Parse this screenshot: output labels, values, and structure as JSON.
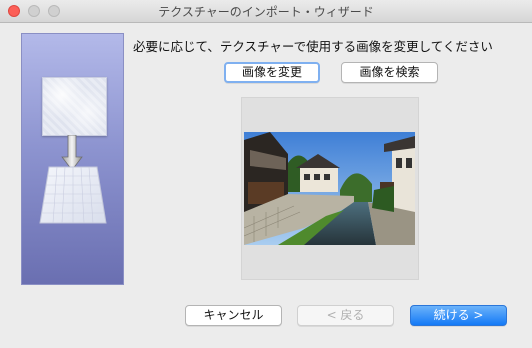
{
  "window": {
    "title": "テクスチャーのインポート・ウィザード"
  },
  "prompt": "必要に応じて、テクスチャーで使用する画像を変更してください",
  "buttons": {
    "change_image": "画像を変更",
    "search_image": "画像を検索",
    "cancel": "キャンセル",
    "back": "< 戻る",
    "next": "続ける >"
  },
  "icons": {
    "side": [
      "texture-square-icon",
      "down-arrow-icon",
      "mapped-texture-icon"
    ],
    "window": [
      "close-icon",
      "minimize-icon",
      "zoom-icon"
    ]
  },
  "colors": {
    "accent": "#1479f6",
    "panel_top": "#b3b9e9",
    "panel_bottom": "#6a6fb1"
  }
}
